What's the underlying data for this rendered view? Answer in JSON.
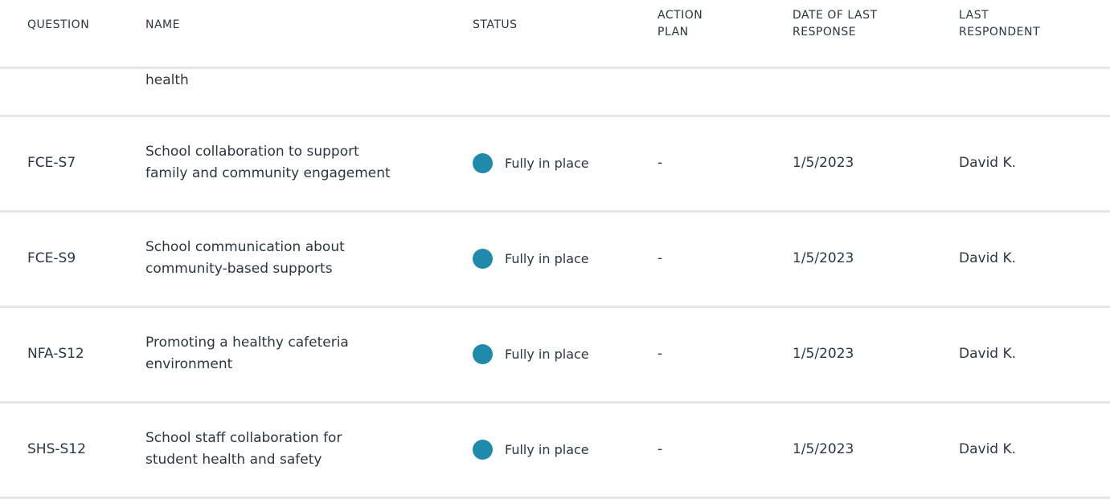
{
  "columns": {
    "question": "QUESTION",
    "name": "NAME",
    "status": "STATUS",
    "action_plan": [
      "ACTION",
      "PLAN"
    ],
    "date_last_response": [
      "DATE OF LAST",
      "RESPONSE"
    ],
    "last_respondent": [
      "LAST",
      "RESPONDENT"
    ]
  },
  "partial_row": {
    "name_tail": "health"
  },
  "rows": [
    {
      "code": "FCE-S7",
      "name": [
        "School collaboration to support",
        "family and community engagement"
      ],
      "status": "Fully in place",
      "action_plan": "-",
      "date": "1/5/2023",
      "respondent": "David K."
    },
    {
      "code": "FCE-S9",
      "name": [
        "School communication about",
        "community-based supports"
      ],
      "status": "Fully in place",
      "action_plan": "-",
      "date": "1/5/2023",
      "respondent": "David K."
    },
    {
      "code": "NFA-S12",
      "name": [
        "Promoting a healthy cafeteria",
        "environment"
      ],
      "status": "Fully in place",
      "action_plan": "-",
      "date": "1/5/2023",
      "respondent": "David K."
    },
    {
      "code": "SHS-S12",
      "name": [
        "School staff collaboration for",
        "student health and safety"
      ],
      "status": "Fully in place",
      "action_plan": "-",
      "date": "1/5/2023",
      "respondent": "David K."
    }
  ],
  "colors": {
    "status_fully_in_place": "#1f8aab",
    "divider": "#e6e6e6",
    "text": "#2e3440"
  }
}
